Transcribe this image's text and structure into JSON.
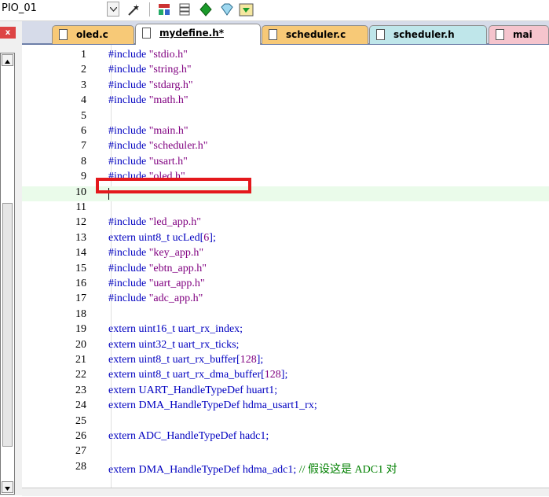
{
  "toolbar": {
    "project_name": "PIO_01",
    "icons": [
      "dropdown-chevron-icon",
      "magic-wand-icon",
      "build-icon",
      "stack-icon",
      "green-diamond-icon",
      "diamond-icon",
      "download-icon"
    ]
  },
  "left_panel": {
    "close_label": "x"
  },
  "tabs": [
    {
      "label": "oled.c",
      "color": "#f7c977"
    },
    {
      "label": "mydefine.h*",
      "color": "#ffffff",
      "active": true
    },
    {
      "label": "scheduler.c",
      "color": "#f7c977"
    },
    {
      "label": "scheduler.h",
      "color": "#bfe6ea"
    },
    {
      "label": "mai",
      "color": "#f5c4cd"
    }
  ],
  "editor": {
    "highlight_color": "#e4181c",
    "current_line_color": "#eafbea",
    "lines": [
      {
        "n": "1",
        "kw": "#include ",
        "str": "\"stdio.h\""
      },
      {
        "n": "2",
        "kw": "#include ",
        "str": "\"string.h\""
      },
      {
        "n": "3",
        "kw": "#include ",
        "str": "\"stdarg.h\""
      },
      {
        "n": "4",
        "kw": "#include ",
        "str": "\"math.h\""
      },
      {
        "n": "5",
        "kw": ""
      },
      {
        "n": "6",
        "kw": "#include ",
        "str": "\"main.h\""
      },
      {
        "n": "7",
        "kw": "#include ",
        "str": "\"scheduler.h\""
      },
      {
        "n": "8",
        "kw": "#include ",
        "str": "\"usart.h\""
      },
      {
        "n": "9",
        "kw": "#include ",
        "str": "\"oled.h\""
      },
      {
        "n": "10",
        "kw": ""
      },
      {
        "n": "11",
        "kw": ""
      },
      {
        "n": "12",
        "kw": "#include ",
        "str": "\"led_app.h\""
      },
      {
        "n": "13",
        "kw": "extern uint8_t ucLed[",
        "num": "6",
        "post": "];"
      },
      {
        "n": "14",
        "kw": "#include ",
        "str": "\"key_app.h\""
      },
      {
        "n": "15",
        "kw": "#include ",
        "str": "\"ebtn_app.h\""
      },
      {
        "n": "16",
        "kw": "#include ",
        "str": "\"uart_app.h\""
      },
      {
        "n": "17",
        "kw": "#include ",
        "str": "\"adc_app.h\""
      },
      {
        "n": "18",
        "kw": ""
      },
      {
        "n": "19",
        "kw": "extern uint16_t uart_rx_index;"
      },
      {
        "n": "20",
        "kw": "extern uint32_t uart_rx_ticks;"
      },
      {
        "n": "21",
        "kw": "extern uint8_t uart_rx_buffer[",
        "num": "128",
        "post": "];"
      },
      {
        "n": "22",
        "kw": "extern uint8_t uart_rx_dma_buffer[",
        "num": "128",
        "post": "];"
      },
      {
        "n": "23",
        "kw": "extern UART_HandleTypeDef huart1;"
      },
      {
        "n": "24",
        "kw": "extern DMA_HandleTypeDef hdma_usart1_rx;"
      },
      {
        "n": "25",
        "kw": ""
      },
      {
        "n": "26",
        "kw": "extern ADC_HandleTypeDef hadc1;"
      },
      {
        "n": "27",
        "kw": ""
      },
      {
        "n": "28",
        "kw": "extern DMA_HandleTypeDef hdma_adc1; ",
        "cmt": "// 假设这是 ADC1 对"
      }
    ]
  }
}
